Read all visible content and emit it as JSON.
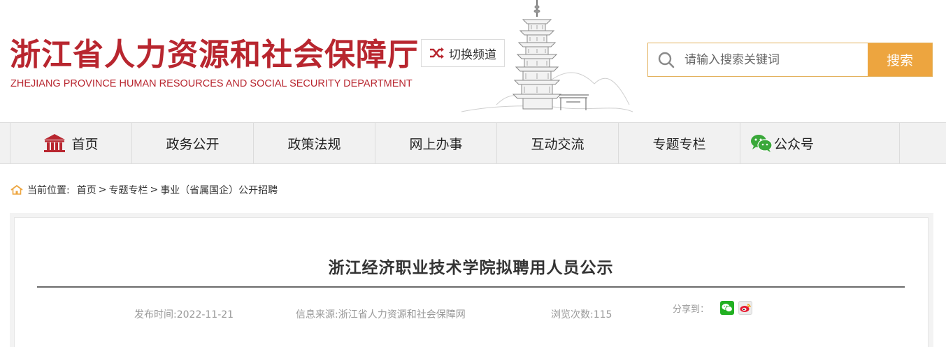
{
  "header": {
    "title": "浙江省人力资源和社会保障厅",
    "subtitle": "ZHEJIANG PROVINCE HUMAN RESOURCES AND SOCIAL SECURITY DEPARTMENT",
    "switch_channel_label": "切换频道",
    "search_placeholder": "请输入搜索关键词",
    "search_button_label": "搜索"
  },
  "nav": {
    "items": [
      {
        "label": "首页",
        "icon": "home-icon"
      },
      {
        "label": "政务公开"
      },
      {
        "label": "政策法规"
      },
      {
        "label": "网上办事"
      },
      {
        "label": "互动交流"
      },
      {
        "label": "专题专栏"
      },
      {
        "label": "公众号",
        "icon": "wechat-icon"
      }
    ]
  },
  "breadcrumb": {
    "prefix": "当前位置:",
    "items": [
      "首页",
      "专题专栏",
      "事业（省属国企）公开招聘"
    ],
    "separator": ">"
  },
  "article": {
    "title": "浙江经济职业技术学院拟聘用人员公示",
    "publish_time": "发布时间:2022-11-21",
    "source": "信息来源:浙江省人力资源和社会保障网",
    "views": "浏览次数:115",
    "share_label": "分享到："
  },
  "colors": {
    "brand_red": "#b8262f",
    "accent_orange": "#eda53f",
    "nav_bg": "#f1f1f1",
    "wechat_green": "#22b022",
    "weibo_red": "#e6162d"
  }
}
